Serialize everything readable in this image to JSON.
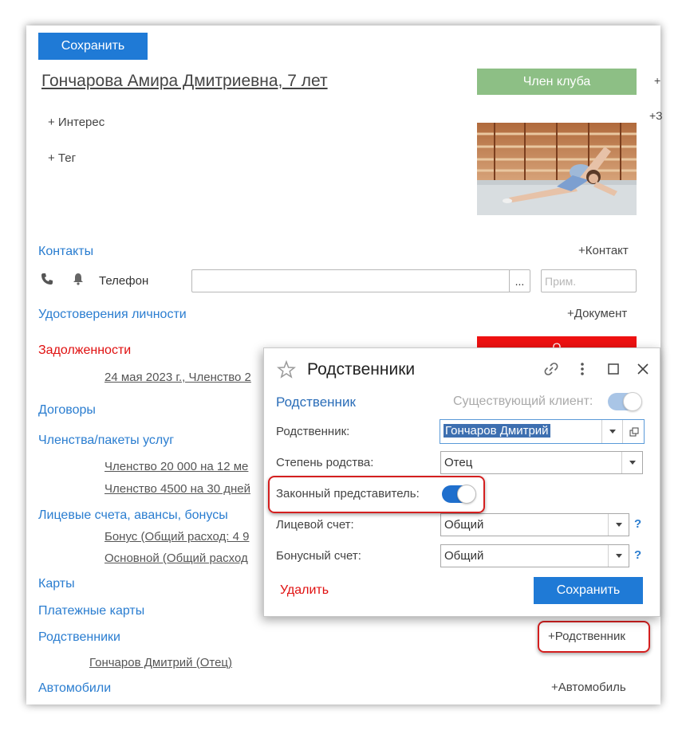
{
  "header": {
    "save_label": "Сохранить",
    "client_name": "Гончарова Амира Дмитриевна, 7 лет",
    "club_member_label": "Член клуба",
    "cut_plus_1": "+",
    "cut_plus_2": "+З"
  },
  "tags": {
    "interest_label": "+ Интерес",
    "tag_label": "+ Тег"
  },
  "contacts": {
    "title": "Контакты",
    "add_label": "+Контакт",
    "phone_label": "Телефон",
    "phone_value": "",
    "ellipsis": "...",
    "note_placeholder": "Прим."
  },
  "identity": {
    "title": "Удостоверения личности",
    "add_label": "+Документ"
  },
  "debts": {
    "title": "Задолженности",
    "badge_text": "О",
    "item": "24 мая 2023 г., Членство 2"
  },
  "contracts": {
    "title": "Договоры"
  },
  "memberships": {
    "title": "Членства/пакеты услуг",
    "items": [
      "Членство 20 000 на 12 ме",
      "Членство 4500 на 30 дней"
    ]
  },
  "accounts": {
    "title": "Лицевые счета, авансы, бонусы",
    "items": [
      "Бонус (Общий расход: 4 9",
      "Основной (Общий расход"
    ]
  },
  "cards": {
    "title": "Карты"
  },
  "payment_cards": {
    "title": "Платежные карты"
  },
  "relatives": {
    "title": "Родственники",
    "add_label": "+Родственник",
    "item": "Гончаров Дмитрий (Отец)"
  },
  "cars": {
    "title": "Автомобили",
    "add_label": "+Автомобиль"
  },
  "dialog": {
    "title": "Родственники",
    "section_title": "Родственник",
    "existing_client_label": "Существующий клиент:",
    "existing_client_on": true,
    "relative_label": "Родственник:",
    "relative_value": "Гончаров Дмитрий",
    "relation_label": "Степень родства:",
    "relation_value": "Отец",
    "legal_rep_label": "Законный представитель:",
    "legal_rep_on": true,
    "account_label": "Лицевой счет:",
    "account_value": "Общий",
    "bonus_label": "Бонусный счет:",
    "bonus_value": "Общий",
    "help": "?",
    "delete_label": "Удалить",
    "save_label": "Сохранить"
  },
  "colors": {
    "primary": "#1f7ad6",
    "link": "#2a7dd0",
    "danger": "#e01010",
    "club_green": "#8dbf85",
    "highlight_frame": "#d41f1f"
  }
}
